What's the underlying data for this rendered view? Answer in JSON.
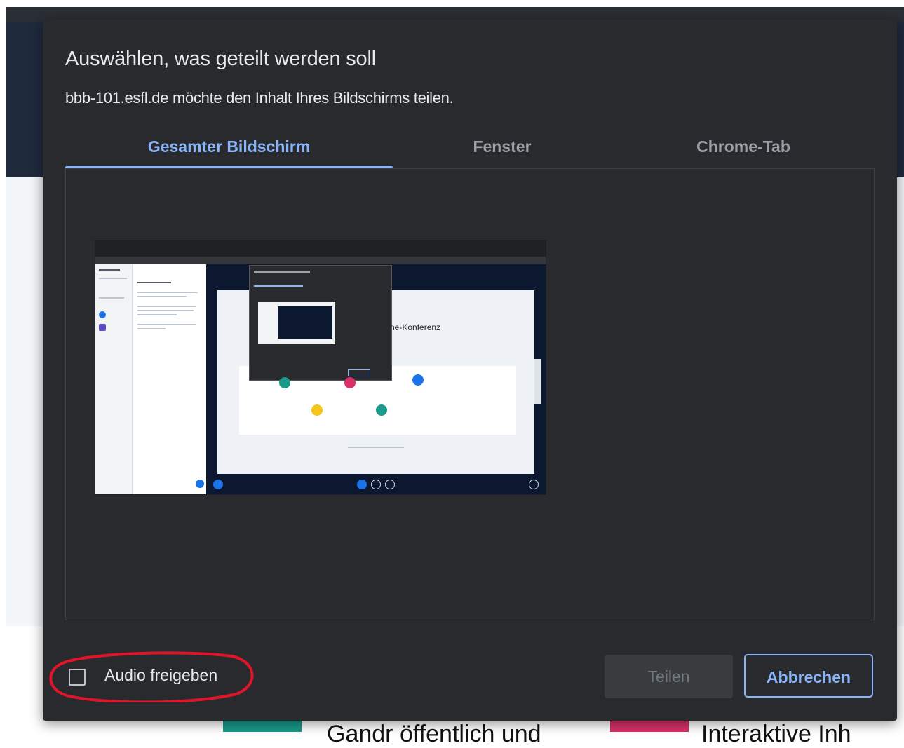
{
  "dialog": {
    "title": "Auswählen, was geteilt werden soll",
    "subtitle": "bbb-101.esfl.de möchte den Inhalt Ihres Bildschirms teilen.",
    "tabs": [
      {
        "label": "Gesamter Bildschirm",
        "active": true
      },
      {
        "label": "Fenster",
        "active": false
      },
      {
        "label": "Chrome-Tab",
        "active": false
      }
    ],
    "preview": {
      "heading": "ne-Konferenz",
      "icon": "screen-thumbnail"
    },
    "audio_checkbox": {
      "label": "Audio freigeben",
      "checked": false
    },
    "buttons": {
      "share": "Teilen",
      "cancel": "Abbrechen"
    }
  },
  "colors": {
    "accent": "#8ab4f8",
    "dialog_bg": "#292a2d",
    "annotation_red": "#e0142a"
  },
  "background": {
    "fragment_1": "Gandr öffentlich und",
    "fragment_2": "Interaktive Inh"
  }
}
